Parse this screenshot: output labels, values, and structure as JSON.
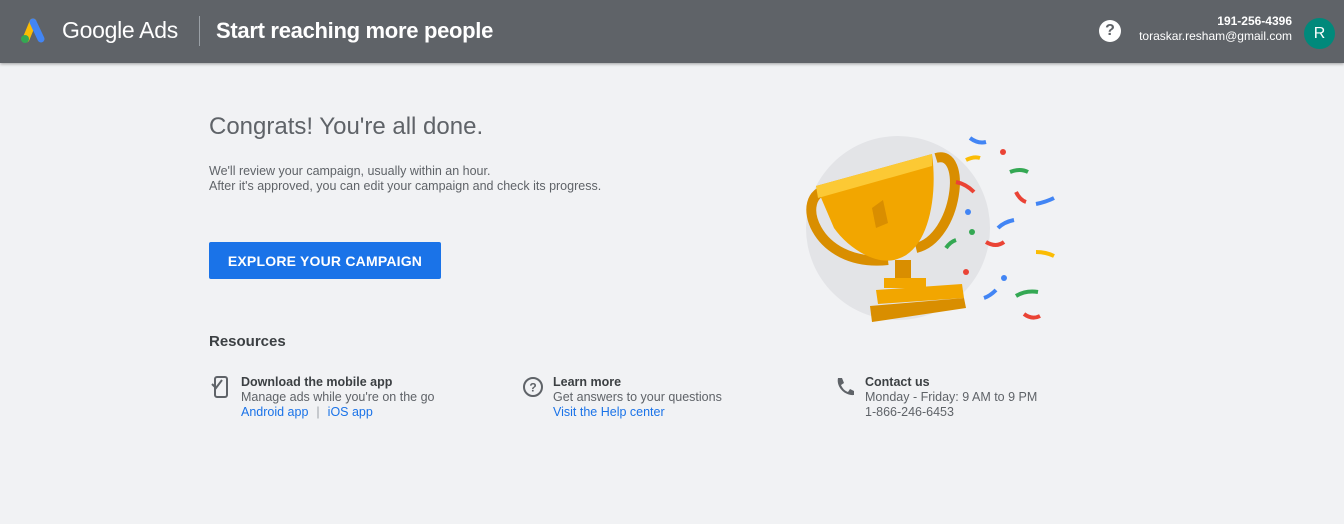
{
  "header": {
    "brand": "Google Ads",
    "page_title": "Start reaching more people",
    "help_icon": "help-circle-icon",
    "account_phone": "191-256-4396",
    "account_email": "toraskar.resham@gmail.com",
    "avatar_letter": "R"
  },
  "main": {
    "headline": "Congrats! You're all done.",
    "description_line1": "We'll review your campaign, usually within an hour.",
    "description_line2": "After it's approved, you can edit your campaign and check its progress.",
    "cta_label": "EXPLORE YOUR CAMPAIGN",
    "illustration": "trophy-with-confetti"
  },
  "resources": {
    "title": "Resources",
    "items": [
      {
        "icon": "mobile-phone-icon",
        "title": "Download the mobile app",
        "subtitle": "Manage ads while you're on the go",
        "link1": "Android app",
        "separator": "|",
        "link2": "iOS app"
      },
      {
        "icon": "help-outline-icon",
        "title": "Learn more",
        "subtitle": "Get answers to your questions",
        "link1": "Visit the Help center"
      },
      {
        "icon": "phone-icon",
        "title": "Contact us",
        "subtitle": "Monday - Friday: 9 AM to 9 PM",
        "phone": "1-866-246-6453"
      }
    ]
  },
  "colors": {
    "topbar": "#5f6368",
    "background": "#f1f2f4",
    "accent": "#1a73e8",
    "avatar": "#00897b",
    "trophy": "#f2a600"
  }
}
